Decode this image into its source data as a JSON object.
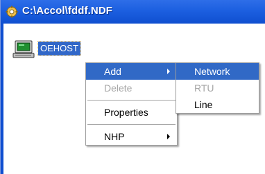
{
  "window": {
    "title": "C:\\Accol\\fddf.NDF",
    "colors": {
      "titlebar": "#1c5fe0",
      "selection": "#3169c6"
    }
  },
  "tree": {
    "node_label": "OEHOST",
    "node_icon": "computer-icon"
  },
  "context_menu": {
    "items": [
      {
        "label": "Add",
        "state": "highlighted",
        "submenu": true
      },
      {
        "label": "Delete",
        "state": "disabled"
      },
      {
        "label": "Properties",
        "state": "enabled"
      },
      {
        "label": "NHP",
        "state": "enabled",
        "submenu": true
      }
    ]
  },
  "submenu": {
    "items": [
      {
        "label": "Network",
        "state": "highlighted"
      },
      {
        "label": "RTU",
        "state": "disabled"
      },
      {
        "label": "Line",
        "state": "enabled"
      }
    ]
  }
}
